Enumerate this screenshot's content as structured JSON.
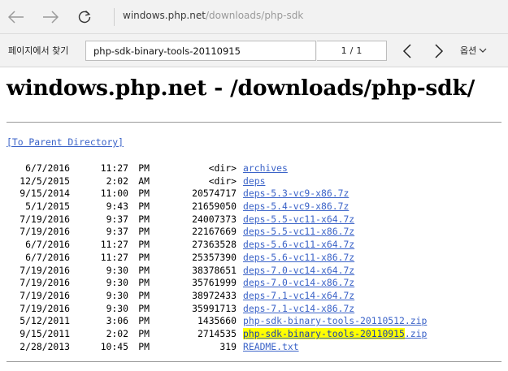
{
  "browser": {
    "address_host": "windows.php.net",
    "address_path": "/downloads/php-sdk"
  },
  "find_bar": {
    "label": "페이지에서 찾기",
    "query": "php-sdk-binary-tools-20110915",
    "current": "1",
    "separator": "/",
    "total": "1",
    "options_label": "옵션"
  },
  "page": {
    "title": "windows.php.net - /downloads/php-sdk/",
    "parent_link": "[To Parent Directory]"
  },
  "listing": [
    {
      "date": "6/7/2016",
      "time": "11:27",
      "ampm": "PM",
      "size": "<dir>",
      "name": "archives"
    },
    {
      "date": "12/5/2015",
      "time": "2:02",
      "ampm": "AM",
      "size": "<dir>",
      "name": "deps"
    },
    {
      "date": "9/15/2014",
      "time": "11:00",
      "ampm": "PM",
      "size": "20574717",
      "name": "deps-5.3-vc9-x86.7z"
    },
    {
      "date": "5/1/2015",
      "time": "9:43",
      "ampm": "PM",
      "size": "21659050",
      "name": "deps-5.4-vc9-x86.7z"
    },
    {
      "date": "7/19/2016",
      "time": "9:37",
      "ampm": "PM",
      "size": "24007373",
      "name": "deps-5.5-vc11-x64.7z"
    },
    {
      "date": "7/19/2016",
      "time": "9:37",
      "ampm": "PM",
      "size": "22167669",
      "name": "deps-5.5-vc11-x86.7z"
    },
    {
      "date": "6/7/2016",
      "time": "11:27",
      "ampm": "PM",
      "size": "27363528",
      "name": "deps-5.6-vc11-x64.7z"
    },
    {
      "date": "6/7/2016",
      "time": "11:27",
      "ampm": "PM",
      "size": "25357390",
      "name": "deps-5.6-vc11-x86.7z"
    },
    {
      "date": "7/19/2016",
      "time": "9:30",
      "ampm": "PM",
      "size": "38378651",
      "name": "deps-7.0-vc14-x64.7z"
    },
    {
      "date": "7/19/2016",
      "time": "9:30",
      "ampm": "PM",
      "size": "35761999",
      "name": "deps-7.0-vc14-x86.7z"
    },
    {
      "date": "7/19/2016",
      "time": "9:30",
      "ampm": "PM",
      "size": "38972433",
      "name": "deps-7.1-vc14-x64.7z"
    },
    {
      "date": "7/19/2016",
      "time": "9:30",
      "ampm": "PM",
      "size": "35991713",
      "name": "deps-7.1-vc14-x86.7z"
    },
    {
      "date": "5/12/2011",
      "time": "3:06",
      "ampm": "PM",
      "size": "1435660",
      "name": "php-sdk-binary-tools-20110512.zip"
    },
    {
      "date": "9/15/2011",
      "time": "2:02",
      "ampm": "PM",
      "size": "2714535",
      "name": "php-sdk-binary-tools-20110915.zip",
      "highlight": "php-sdk-binary-tools-20110915",
      "rest": ".zip"
    },
    {
      "date": "2/28/2013",
      "time": "10:45",
      "ampm": "PM",
      "size": "319",
      "name": "README.txt"
    }
  ],
  "colors": {
    "link": "#3b63c8",
    "find_highlight": "#ffff00",
    "chrome_bg": "#f2f2f2"
  }
}
